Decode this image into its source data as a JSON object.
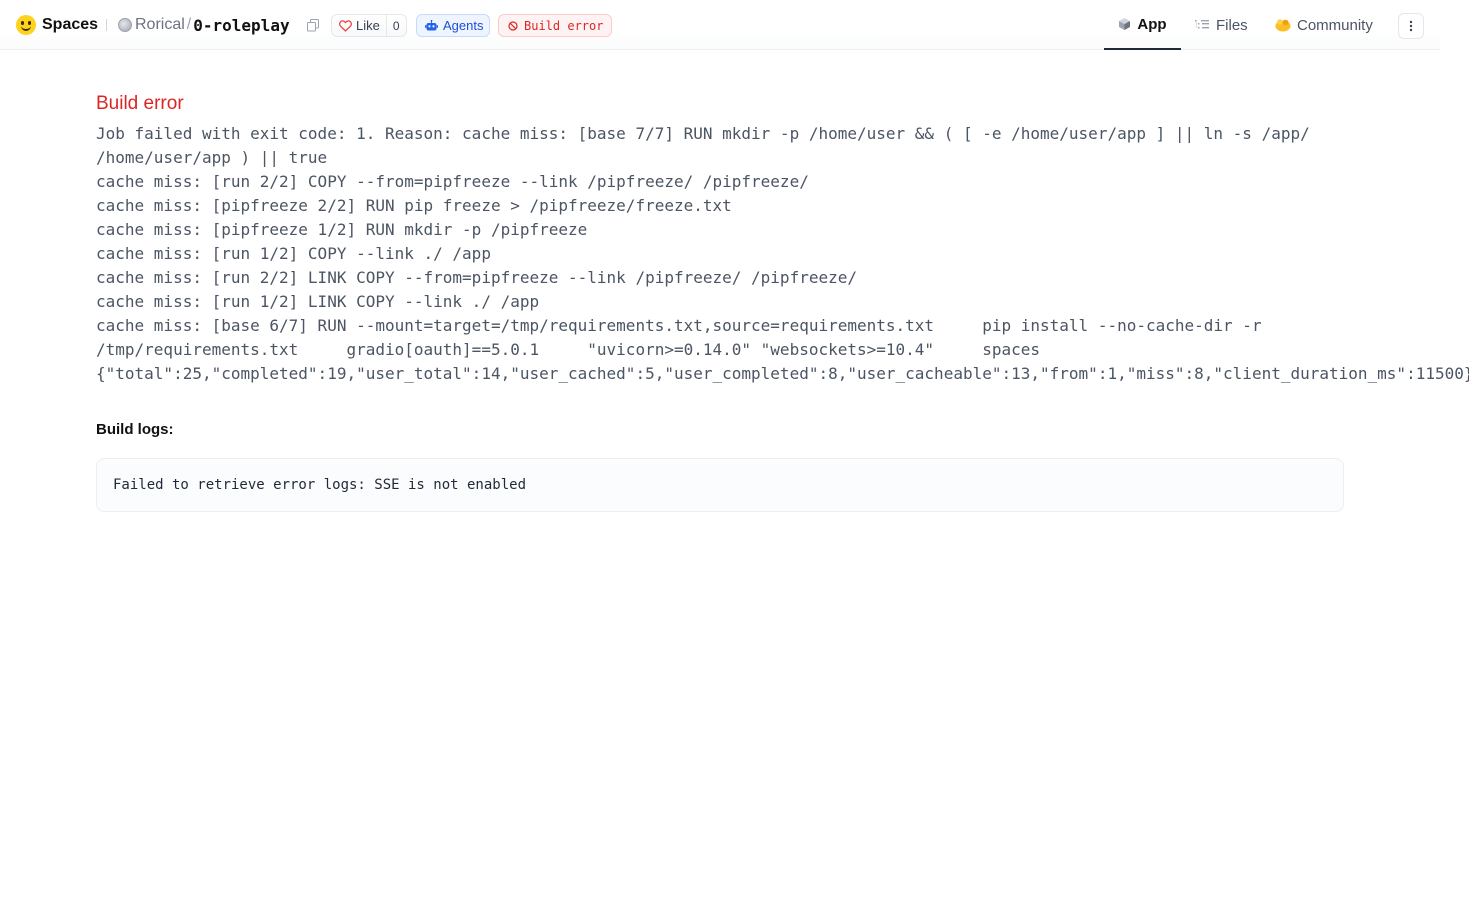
{
  "header": {
    "brand_label": "Spaces",
    "owner": "Rorical",
    "separator": "/",
    "repo_name": "0-roleplay",
    "like_label": "Like",
    "like_count": "0",
    "agents_label": "Agents",
    "status_label": "Build error",
    "colors": {
      "status": "#dc2626",
      "agents": "#1d4ed8",
      "brand_emoji": "#ffd21e"
    }
  },
  "tabs": [
    {
      "label": "App",
      "icon": "cube-icon",
      "active": true
    },
    {
      "label": "Files",
      "icon": "files-icon",
      "active": false
    },
    {
      "label": "Community",
      "icon": "community-icon",
      "active": false
    }
  ],
  "main": {
    "error_title": "Build error",
    "error_lines": [
      "Job failed with exit code: 1. Reason: cache miss: [base 7/7] RUN mkdir -p /home/user && ( [ -e /home/user/app ] || ln -s /app/",
      "/home/user/app ) || true",
      "cache miss: [run 2/2] COPY --from=pipfreeze --link /pipfreeze/ /pipfreeze/",
      "cache miss: [pipfreeze 2/2] RUN pip freeze > /pipfreeze/freeze.txt",
      "cache miss: [pipfreeze 1/2] RUN mkdir -p /pipfreeze",
      "cache miss: [run 1/2] COPY --link ./ /app",
      "cache miss: [run 2/2] LINK COPY --from=pipfreeze --link /pipfreeze/ /pipfreeze/",
      "cache miss: [run 1/2] LINK COPY --link ./ /app",
      "cache miss: [base 6/7] RUN --mount=target=/tmp/requirements.txt,source=requirements.txt     pip install --no-cache-dir -r",
      "/tmp/requirements.txt     gradio[oauth]==5.0.1     \"uvicorn>=0.14.0\" \"websockets>=10.4\"     spaces",
      "{\"total\":25,\"completed\":19,\"user_total\":14,\"user_cached\":5,\"user_completed\":8,\"user_cacheable\":13,\"from\":1,\"miss\":8,\"client_duration_ms\":11500}"
    ],
    "logs_title": "Build logs:",
    "logs_text": "Failed to retrieve error logs: SSE is not enabled"
  }
}
